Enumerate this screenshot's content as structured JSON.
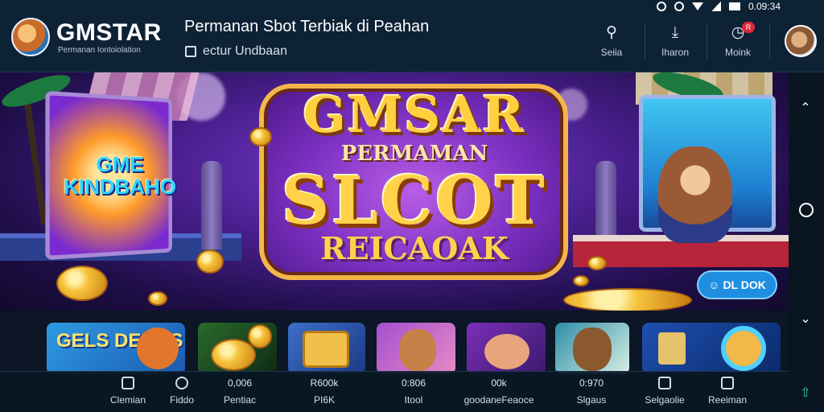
{
  "header": {
    "brand": "GMSTAR",
    "brand_sub": "Permanan Iontoiolation",
    "title": "Permanan Sbot Terbiak di Peahan",
    "sub_link": "ectur Undbaan",
    "status_time": "0.09:34",
    "nav": [
      {
        "label": "Seiia",
        "icon": "search-icon"
      },
      {
        "label": "Iharon",
        "icon": "download-icon"
      },
      {
        "label": "Moink",
        "icon": "notification-icon",
        "badge": "R"
      }
    ]
  },
  "banner": {
    "logo": "GMSAR",
    "subtitle": "PERMAMAN",
    "main": "SLCOT",
    "tagline": "REICAOAK",
    "left_screen_text": "GME KINDBAHO",
    "cta": "DL DOK",
    "cta_icon": "smiley-icon"
  },
  "tiles": [
    {
      "text": "GELS DEMES",
      "bg": "#2f9ae3"
    },
    {
      "text": "",
      "bg": "#2a6b2b"
    },
    {
      "text": "",
      "bg": "#3c6fc8"
    },
    {
      "text": "",
      "bg": "#a44fd0"
    },
    {
      "text": "",
      "bg": "#7b2fb8"
    },
    {
      "text": "",
      "bg": "#2e8ea6"
    },
    {
      "text": "",
      "bg": "#1e4fb0"
    }
  ],
  "bottom_nav": [
    {
      "value": "",
      "label": "Clemian"
    },
    {
      "value": "",
      "label": "Fiddo"
    },
    {
      "value": "0,006",
      "label": "Pentiac"
    },
    {
      "value": "R600k",
      "label": "PI6K"
    },
    {
      "value": "0:806",
      "label": "Itool"
    },
    {
      "value": "00k",
      "label": "goodaneFeaoce"
    },
    {
      "value": "0:970",
      "label": "Slgaus"
    },
    {
      "value": "",
      "label": "Selgaolie"
    },
    {
      "value": "",
      "label": "Reeiman"
    }
  ]
}
